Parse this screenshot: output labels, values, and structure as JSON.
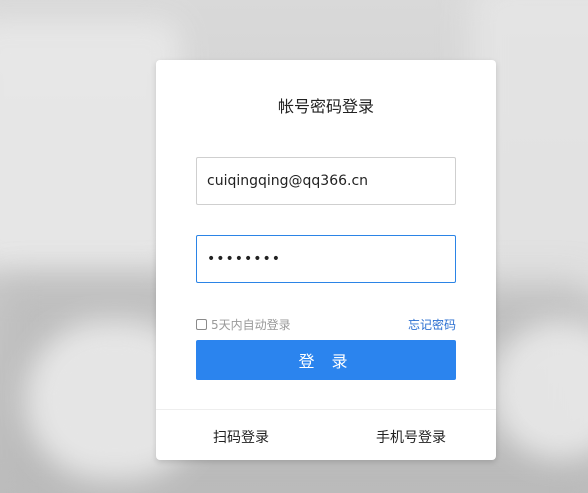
{
  "login_card": {
    "title": "帐号密码登录",
    "username_value": "cuiqingqing@qq366.cn",
    "password_value": "••••••••",
    "remember_label": "5天内自动登录",
    "forgot_label": "忘记密码",
    "login_button": "登 录",
    "alt_login_qr": "扫码登录",
    "alt_login_phone": "手机号登录"
  },
  "colors": {
    "accent": "#2b84ee",
    "link": "#2b6fd1"
  }
}
